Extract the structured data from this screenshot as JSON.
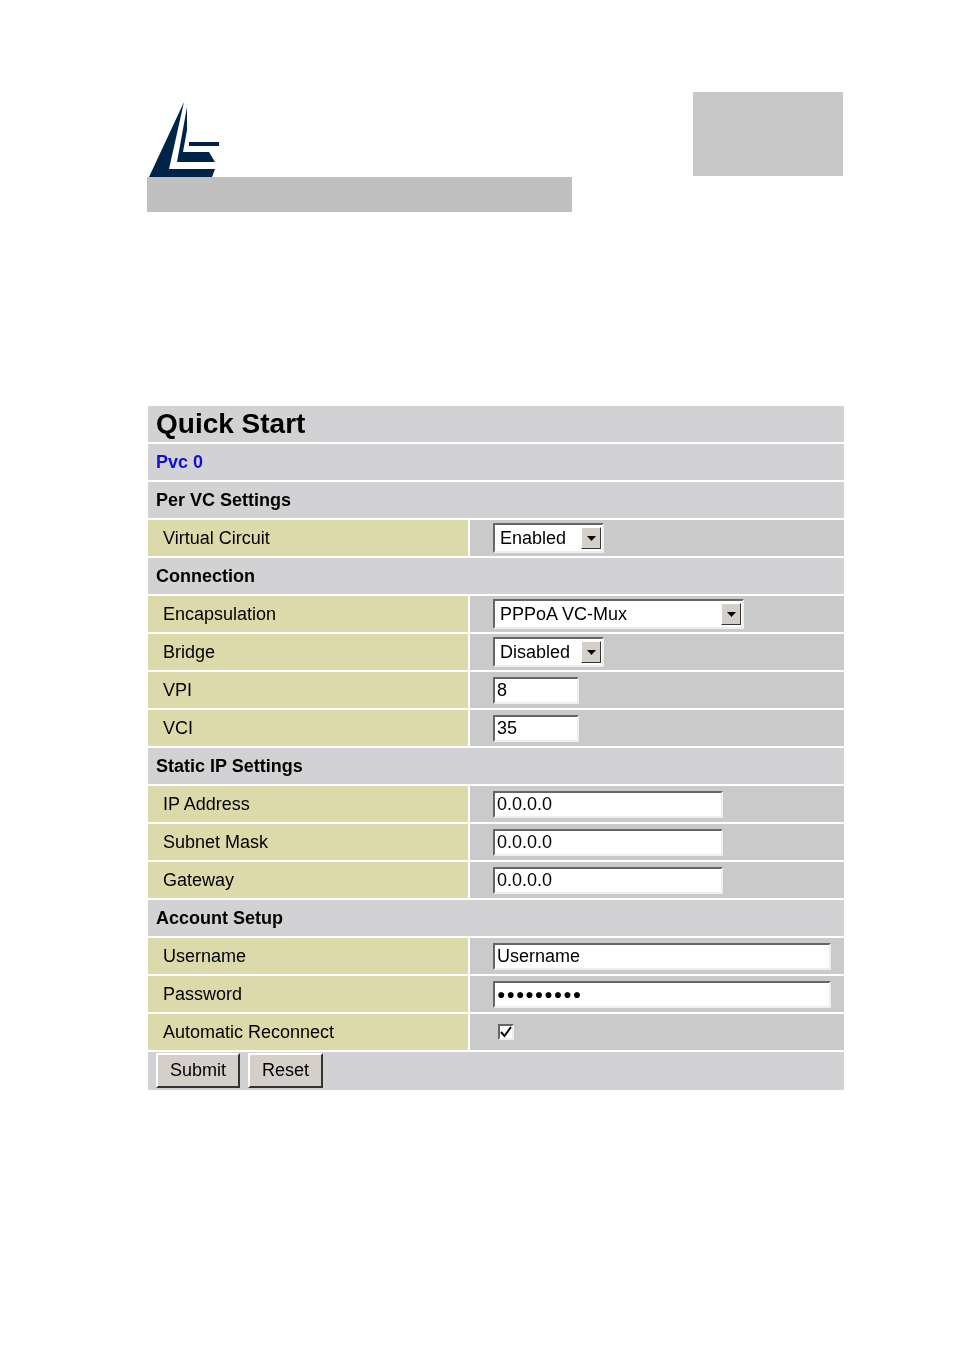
{
  "title": "Quick Start",
  "pvc": "Pvc 0",
  "rows": [
    {
      "kind": "section",
      "label": "Per VC Settings"
    },
    {
      "kind": "select",
      "label": "Virtual Circuit",
      "value": "Enabled"
    },
    {
      "kind": "section",
      "label": "Connection"
    },
    {
      "kind": "select",
      "label": "Encapsulation",
      "value": "PPPoA VC-Mux"
    },
    {
      "kind": "select",
      "label": "Bridge",
      "value": "Disabled"
    },
    {
      "kind": "text",
      "label": "VPI",
      "value": "8"
    },
    {
      "kind": "text",
      "label": "VCI",
      "value": "35"
    },
    {
      "kind": "section",
      "label": "Static IP Settings"
    },
    {
      "kind": "text",
      "label": "IP Address",
      "value": "0.0.0.0"
    },
    {
      "kind": "text",
      "label": "Subnet Mask",
      "value": "0.0.0.0"
    },
    {
      "kind": "text",
      "label": "Gateway",
      "value": "0.0.0.0"
    },
    {
      "kind": "section",
      "label": "Account Setup"
    },
    {
      "kind": "text",
      "label": "Username",
      "value": "Username"
    },
    {
      "kind": "password",
      "label": "Password",
      "value": "●●●●●●●●●"
    },
    {
      "kind": "checkbox",
      "label": "Automatic Reconnect",
      "checked": true
    }
  ],
  "buttons": [
    "Submit",
    "Reset"
  ]
}
